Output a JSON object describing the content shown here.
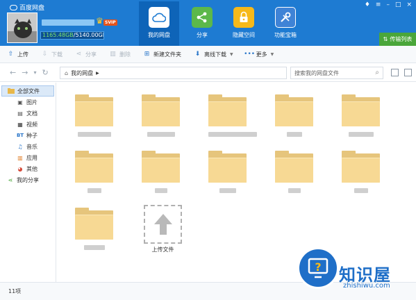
{
  "app": {
    "title": "百度网盘"
  },
  "user": {
    "badge": "SVIP",
    "quota_used": "1165.48GB",
    "quota_total": "/5140.00GB"
  },
  "nav": [
    {
      "label": "我的网盘",
      "icon": "cloud-icon",
      "active": true
    },
    {
      "label": "分享",
      "icon": "share-icon",
      "active": false
    },
    {
      "label": "隐藏空间",
      "icon": "lock-icon",
      "active": false
    },
    {
      "label": "功能宝箱",
      "icon": "toolbox-icon",
      "active": false
    }
  ],
  "window_controls": [
    "♦",
    "≡",
    "–",
    "□",
    "×"
  ],
  "transfer_label": "传输列表",
  "toolbar": {
    "upload": "上传",
    "download": "下载",
    "share": "分享",
    "delete": "删除",
    "new_folder": "新建文件夹",
    "offline_download": "离线下载",
    "more": "更多"
  },
  "addressbar": {
    "path_root": "我的网盘",
    "search_placeholder": "搜索我的网盘文件"
  },
  "sidebar": {
    "all_files": "全部文件",
    "items": [
      {
        "label": "图片",
        "icon": "image-icon"
      },
      {
        "label": "文档",
        "icon": "document-icon"
      },
      {
        "label": "视频",
        "icon": "video-icon"
      },
      {
        "label": "种子",
        "icon": "bt-icon"
      },
      {
        "label": "音乐",
        "icon": "music-icon"
      },
      {
        "label": "应用",
        "icon": "app-icon"
      },
      {
        "label": "其他",
        "icon": "other-icon"
      }
    ],
    "my_share": "我的分享"
  },
  "upload_label": "上传文件",
  "status": {
    "count": "11项"
  },
  "watermark": {
    "brand": "知识屋",
    "url": "zhishiwu.com"
  },
  "colors": {
    "header_blue": "#1e7bd2",
    "active_tab": "#0e64b8",
    "folder": "#f7d994",
    "transfer_green": "#4aa63a"
  }
}
